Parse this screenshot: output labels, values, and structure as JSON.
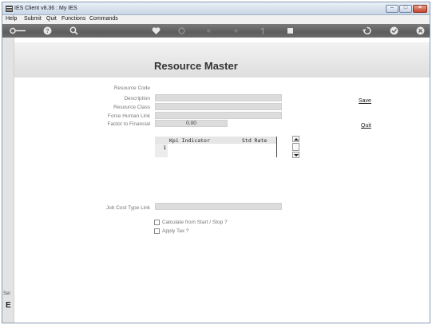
{
  "window": {
    "title": "IES Client v8.36 : My IES"
  },
  "menu": {
    "items": [
      "Help",
      "Submit",
      "Quit",
      "Functions",
      "Commands"
    ]
  },
  "toolbar": {
    "icons": [
      "key-icon",
      "help-icon",
      "search-icon",
      "heart-icon",
      "refresh-icon",
      "first-icon",
      "last-icon",
      "up-icon",
      "stop-icon",
      "back-icon",
      "confirm-icon",
      "close-icon"
    ]
  },
  "form": {
    "title": "Resource Master",
    "labels": {
      "resource_code": "Resource Code",
      "description": "Description",
      "resource_class": "Resource Class",
      "force_human_link": "Force Human Link",
      "factor_to_financial": "Factor to Financial",
      "job_cost_type_link": "Job Cost Type Link"
    },
    "values": {
      "resource_code": "",
      "description": "",
      "resource_class": "",
      "force_human_link": "",
      "factor_to_financial": "0.00",
      "job_cost_type_link": ""
    },
    "grid": {
      "columns": [
        "Kpi Indicator",
        "Std Rate"
      ],
      "rows": [
        "1"
      ]
    },
    "checkboxes": {
      "calculate": "Calculate from Start / Stop ?",
      "apply_tax": "Apply Tax ?"
    },
    "actions": {
      "save": "Save",
      "quit": "Quit"
    }
  },
  "sidebar": {
    "sel_label": "Sel",
    "letter": "E"
  }
}
